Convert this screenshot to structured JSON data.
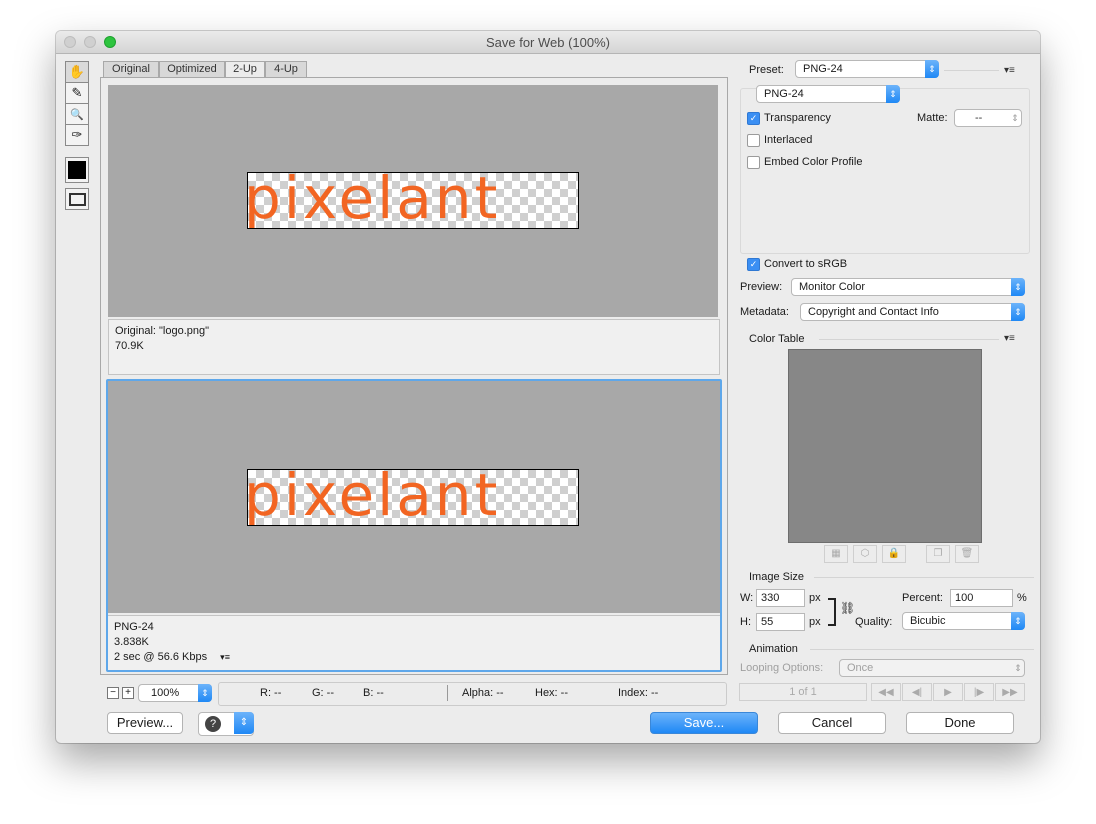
{
  "window": {
    "title": "Save for Web (100%)"
  },
  "tools": [
    {
      "icon": "hand-icon",
      "glyph": "✋"
    },
    {
      "icon": "slice-select-icon",
      "glyph": "✎"
    },
    {
      "icon": "zoom-icon",
      "glyph": "🔍"
    },
    {
      "icon": "eyedropper-icon",
      "glyph": "✑"
    }
  ],
  "tabs": [
    "Original",
    "Optimized",
    "2-Up",
    "4-Up"
  ],
  "top_pane": {
    "logo_text": "pixelant",
    "info_line1": "Original: \"logo.png\"",
    "info_line2": "70.9K"
  },
  "bottom_pane": {
    "logo_text": "pixelant",
    "info_line1": "PNG-24",
    "info_line2": "3.838K",
    "info_line3": "2 sec @ 56.6 Kbps",
    "menu_glyph": "▾≡"
  },
  "status": {
    "zoom": "100%",
    "r": "R: --",
    "g": "G: --",
    "b": "B: --",
    "alpha": "Alpha: --",
    "hex": "Hex: --",
    "index": "Index: --",
    "minus": "−",
    "plus": "+"
  },
  "buttons": {
    "preview": "Preview...",
    "save": "Save...",
    "cancel": "Cancel",
    "done": "Done"
  },
  "preset": {
    "label": "Preset:",
    "value": "PNG-24",
    "format": "PNG-24",
    "menu_glyph": "▾≡"
  },
  "options": {
    "transparency": "Transparency",
    "matte_label": "Matte:",
    "matte_value": "--",
    "interlaced": "Interlaced",
    "embed_profile": "Embed Color Profile",
    "convert_srgb": "Convert to sRGB",
    "preview_label": "Preview:",
    "preview_value": "Monitor Color",
    "metadata_label": "Metadata:",
    "metadata_value": "Copyright and Contact Info"
  },
  "color_table": {
    "title": "Color Table",
    "menu_glyph": "▾≡"
  },
  "image_size": {
    "title": "Image Size",
    "w_label": "W:",
    "w_value": "330",
    "h_label": "H:",
    "h_value": "55",
    "unit": "px",
    "percent_label": "Percent:",
    "percent_value": "100",
    "percent_unit": "%",
    "quality_label": "Quality:",
    "quality_value": "Bicubic"
  },
  "animation": {
    "title": "Animation",
    "looping_label": "Looping Options:",
    "looping_value": "Once",
    "frame_counter": "1 of 1"
  },
  "colors": {
    "accent": "#1f88f5",
    "logo_orange": "#f26522",
    "selection_border": "#5ea7ea"
  }
}
